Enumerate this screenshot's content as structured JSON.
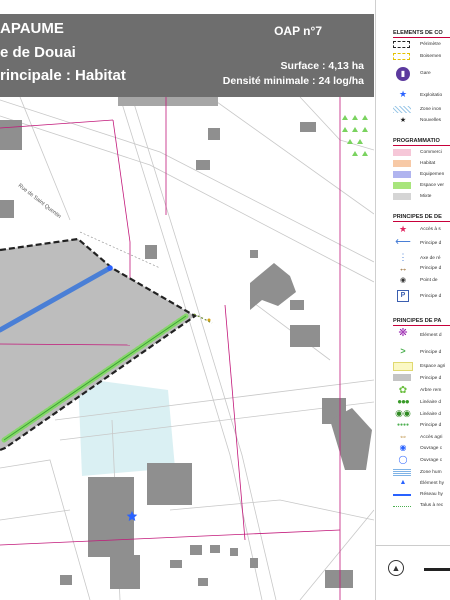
{
  "header": {
    "title_line1": "APAUME",
    "title_line2": "e de Douai",
    "title_line3": "rincipale : Habitat",
    "oap_label": "OAP n°7",
    "surface": "Surface : 4,13 ha",
    "densite": "Densité minimale : 24 log/ha"
  },
  "map": {
    "street_label": "Rue de Saint Quentin",
    "colors": {
      "perimeter": "#222222",
      "boundary": "#c2187a",
      "building": "#8f8f8f",
      "parcel": "#bdbdbd",
      "mixed_zone": "#d9d9d9",
      "vegetal_band": "#86d66a",
      "blue_axis": "#4a7fd6",
      "star": "#2962ff",
      "light_zone": "#d6eef2"
    }
  },
  "legend": {
    "s1": {
      "heading": "ELEMENTS DE CO",
      "items": [
        {
          "label": "Périmètre",
          "icon": "dashed-rect-icon"
        },
        {
          "label": "Boisemen",
          "icon": "yellow-dashed-rect-icon"
        },
        {
          "label": "Gare",
          "icon": "train-icon"
        },
        {
          "label": "Exploitatio",
          "icon": "star-icon"
        },
        {
          "label": "Zone inon",
          "icon": "hatch-icon"
        },
        {
          "label": "Nouvelles",
          "icon": "small-star-icon"
        }
      ]
    },
    "s2": {
      "heading": "PROGRAMMATIO",
      "items": [
        {
          "label": "Commerci",
          "color": "#f6c7d8"
        },
        {
          "label": "Habitat",
          "color": "#f7c9a6"
        },
        {
          "label": "Equipemen",
          "color": "#b0b4ef"
        },
        {
          "label": "Espace ver",
          "color": "#a8e57c"
        },
        {
          "label": "Mixte",
          "color": "#d5d5d5"
        }
      ]
    },
    "s3": {
      "heading": "PRINCIPES DE DE",
      "items": [
        {
          "label": "Accès à s",
          "icon": "pink-star-icon"
        },
        {
          "label": "Principe d",
          "icon": "blue-arrow-icon"
        },
        {
          "label": "Axe de ré",
          "icon": "blue-dash-icon"
        },
        {
          "label": "Principe d",
          "icon": "double-arrow-icon"
        },
        {
          "label": "Point de",
          "icon": "point-icon"
        },
        {
          "label": "Principe d",
          "icon": "parking-icon"
        }
      ]
    },
    "s4": {
      "heading": "PRINCIPES DE PA",
      "items": [
        {
          "label": "Elément d",
          "icon": "asterisk-icon"
        },
        {
          "label": "Principe d",
          "icon": "chevron-icon"
        },
        {
          "label": "Espace agri",
          "icon": "light-yellow-icon"
        },
        {
          "label": "Principe d",
          "icon": "grey-square-icon"
        },
        {
          "label": "Arbre rem",
          "icon": "tree-icon"
        },
        {
          "label": "Linéaire d",
          "icon": "tree-row-icon"
        },
        {
          "label": "Linéaire d",
          "icon": "tree-pair-icon"
        },
        {
          "label": "Principe d",
          "icon": "dot-line-icon"
        },
        {
          "label": "Accès agri",
          "icon": "brown-double-arrow-icon"
        },
        {
          "label": "Ouvrage c",
          "icon": "blue-circle-icon"
        },
        {
          "label": "Ouvrage c",
          "icon": "blue-circle-outline-icon"
        },
        {
          "label": "Zone hum",
          "icon": "wetland-icon"
        },
        {
          "label": "Élément hy",
          "icon": "triangle-icon"
        },
        {
          "label": "Réseau hy",
          "icon": "blue-line-icon"
        },
        {
          "label": "Talus à rec",
          "icon": "dotted-line-icon"
        }
      ]
    }
  }
}
